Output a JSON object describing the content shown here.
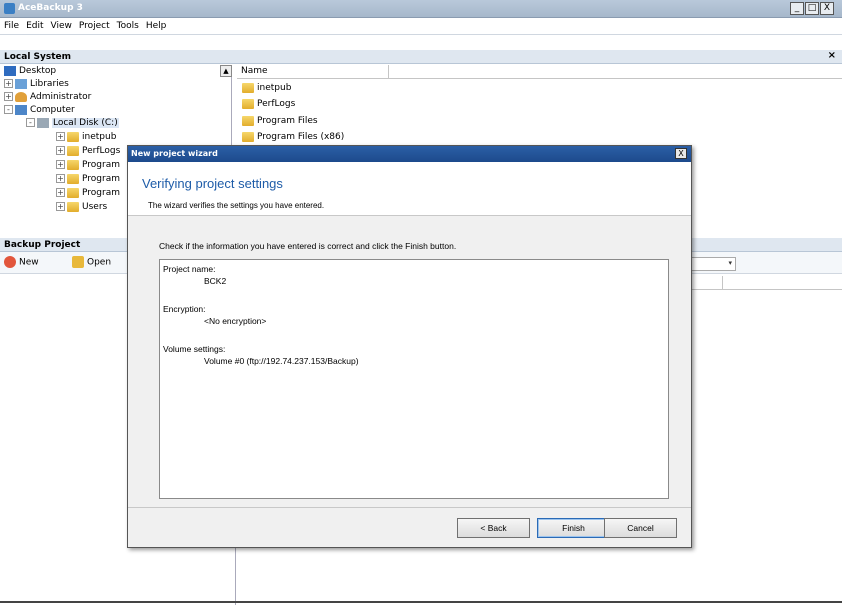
{
  "window": {
    "title": "AceBackup 3",
    "controls": [
      "_",
      "□",
      "X"
    ]
  },
  "menu": [
    "File",
    "Edit",
    "View",
    "Project",
    "Tools",
    "Help"
  ],
  "local_system": {
    "header": "Local System",
    "close": "×",
    "tree": [
      {
        "label": "Desktop",
        "icon": "desktop-icon",
        "expander": ""
      },
      {
        "label": "Libraries",
        "icon": "libraries-icon",
        "expander": "+"
      },
      {
        "label": "Administrator",
        "icon": "user-icon",
        "expander": "+"
      },
      {
        "label": "Computer",
        "icon": "computer-icon",
        "expander": "-"
      },
      {
        "label": "Local Disk (C:)",
        "icon": "disk-icon",
        "expander": "-"
      },
      {
        "label": "inetpub",
        "icon": "folder-icon",
        "expander": "+"
      },
      {
        "label": "PerfLogs",
        "icon": "folder-icon",
        "expander": "+"
      },
      {
        "label": "Program",
        "icon": "folder-icon",
        "expander": "+"
      },
      {
        "label": "Program",
        "icon": "folder-icon",
        "expander": "+"
      },
      {
        "label": "Program",
        "icon": "folder-icon",
        "expander": "+"
      },
      {
        "label": "Users",
        "icon": "folder-icon",
        "expander": "+"
      }
    ],
    "files": {
      "column": "Name",
      "items": [
        "inetpub",
        "PerfLogs",
        "Program Files",
        "Program Files (x86)"
      ]
    }
  },
  "backup_project": {
    "header": "Backup Project",
    "toolbar": {
      "new": "New",
      "open": "Open"
    }
  },
  "dialog": {
    "title": "New project wizard",
    "close": "X",
    "heading": "Verifying project settings",
    "subheading": "The wizard verifies the settings you have entered.",
    "instruction": "Check if the information you have entered is correct and click the Finish button.",
    "summary": {
      "project_name_label": "Project name:",
      "project_name_value": "BCK2",
      "encryption_label": "Encryption:",
      "encryption_value": "<No encryption>",
      "volume_label": "Volume settings:",
      "volume_value": "Volume #0 (ftp://192.74.237.153/Backup)"
    },
    "buttons": {
      "back": "< Back",
      "finish": "Finish",
      "cancel": "Cancel"
    }
  }
}
